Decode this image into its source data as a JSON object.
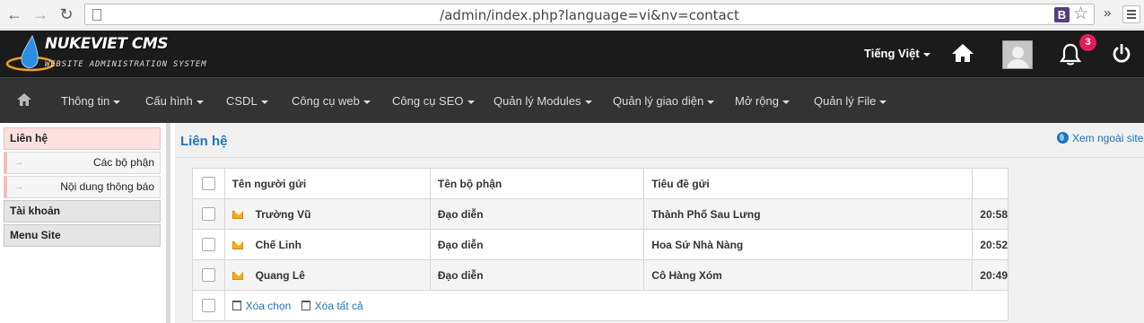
{
  "browser": {
    "url": "/admin/index.php?language=vi&nv=contact",
    "extension_label": "B",
    "icons": [
      "back-arrow-icon",
      "forward-arrow-icon",
      "reload-icon",
      "page-icon",
      "star-icon",
      "more-icon",
      "menu-icon"
    ]
  },
  "header": {
    "logo_title": "NUKEVIET CMS",
    "logo_subtitle": "WEBSITE ADMINISTRATION SYSTEM",
    "language": "Tiếng Việt",
    "notification_count": "3",
    "icons": [
      "home-icon",
      "avatar",
      "bell-icon",
      "power-icon"
    ]
  },
  "nav": {
    "items": [
      "Thông tin",
      "Cấu hình",
      "CSDL",
      "Công cụ web",
      "Công cụ SEO",
      "Quản lý Modules",
      "Quản lý giao diện",
      "Mở rộng",
      "Quản lý File"
    ]
  },
  "sidebar": {
    "contact": "Liên hệ",
    "sub_items": [
      "Các bộ phận",
      "Nội dung thông báo"
    ],
    "account": "Tài khoản",
    "menu_site": "Menu Site"
  },
  "main": {
    "title": "Liên hệ",
    "view_site": "Xem ngoài site",
    "table": {
      "headers": [
        "Tên người gửi",
        "Tên bộ phận",
        "Tiêu đề gửi"
      ],
      "rows": [
        {
          "sender": "Trường Vũ",
          "department": "Đạo diễn",
          "subject": "Thành Phố Sau Lưng",
          "time": "20:58"
        },
        {
          "sender": "Chế Linh",
          "department": "Đạo diễn",
          "subject": "Hoa Sứ Nhà Nàng",
          "time": "20:52"
        },
        {
          "sender": "Quang Lê",
          "department": "Đạo diễn",
          "subject": "Cô Hàng Xóm",
          "time": "20:49"
        }
      ],
      "delete_selected": "Xóa chọn",
      "delete_all": "Xóa tất cả"
    }
  },
  "colors": {
    "header_bg": "#1b1b1b",
    "nav_bg": "#333333",
    "link": "#1e73be",
    "badge": "#e01e5a",
    "sidebar_active": "#fde0e0"
  }
}
